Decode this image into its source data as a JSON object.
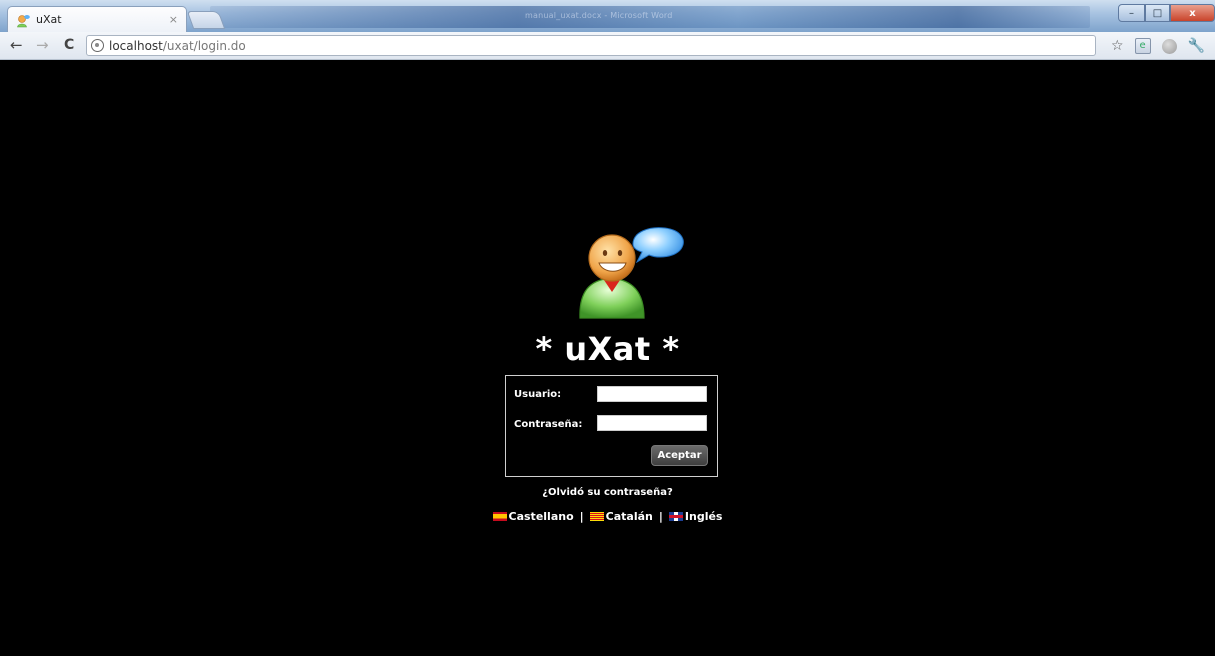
{
  "browser": {
    "tab_title": "uXat",
    "tab_close": "×",
    "url_host": "localhost",
    "url_path": "/uxat/login.do",
    "window_title_blurred": "manual_uxat.docx - Microsoft Word",
    "controls": {
      "minimize": "–",
      "maximize": "□",
      "close": "x"
    },
    "nav": {
      "back": "←",
      "forward": "→",
      "reload": "C",
      "bookmark": "☆",
      "settings": "🔧"
    }
  },
  "page": {
    "title": "* uXat *",
    "form": {
      "user_label": "Usuario:",
      "user_value": "",
      "password_label": "Contraseña:",
      "password_value": "",
      "submit_label": "Aceptar"
    },
    "forgot_password": "¿Olvidó su contraseña?",
    "languages": [
      {
        "label": "Castellano",
        "flag": "flag-es"
      },
      {
        "label": "Catalán",
        "flag": "flag-ca"
      },
      {
        "label": "Inglés",
        "flag": "flag-en"
      }
    ],
    "separator": "|"
  },
  "colors": {
    "background": "#000000",
    "text": "#ffffff",
    "button": "#4f4f4f"
  }
}
